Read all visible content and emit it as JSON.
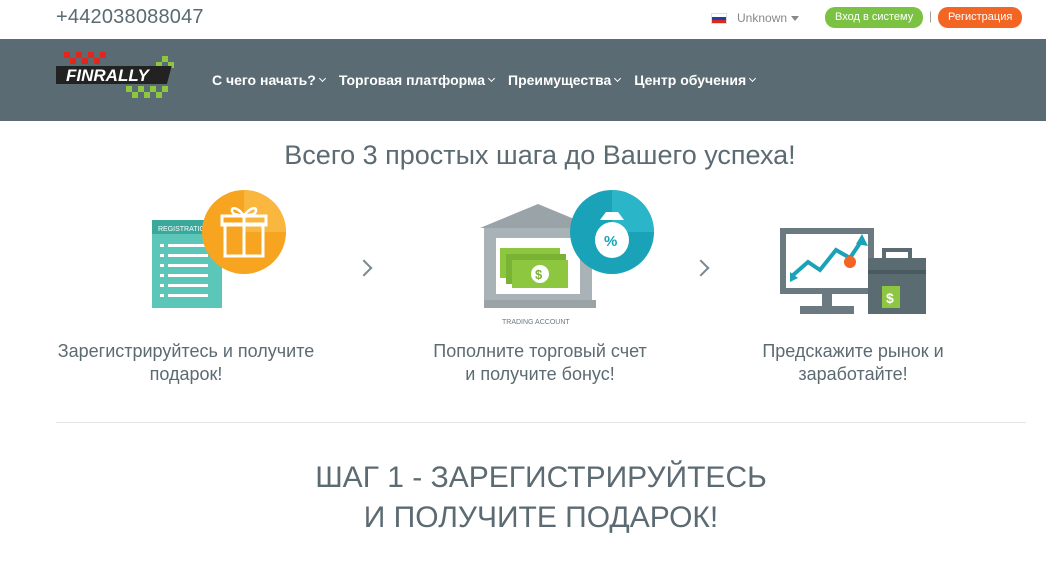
{
  "topbar": {
    "phone": "+442038088047",
    "language": "Unknown",
    "login_label": "Вход в систему",
    "separator": "|",
    "register_label": "Регистрация"
  },
  "navbar": {
    "logo_text": "FINRALLY",
    "items": [
      {
        "label": "С чего начать?"
      },
      {
        "label": "Торговая платформа"
      },
      {
        "label": "Преимущества"
      },
      {
        "label": "Центр обучения"
      }
    ]
  },
  "hero": {
    "title": "Всего 3 простых шага до Вашего успеха!",
    "steps": [
      {
        "lines": [
          "Зарегистрируйтесь и получите",
          "подарок!"
        ],
        "icon": "registration-gift-icon",
        "icon_caption": "REGISTRATION"
      },
      {
        "lines": [
          "Пополните торговый счет",
          "и получите бонус!"
        ],
        "icon": "trading-account-icon",
        "icon_caption": "TRADING ACCOUNT"
      },
      {
        "lines": [
          "Предскажите рынок и",
          "заработайте!"
        ],
        "icon": "monitor-chart-briefcase-icon"
      }
    ]
  },
  "section": {
    "heading_line1": "ШАГ 1 - ЗАРЕГИСТРИРУЙТЕСЬ",
    "heading_line2": "И ПОЛУЧИТЕ ПОДАРОК!"
  },
  "colors": {
    "nav_bg": "#5a6b73",
    "login_green": "#7cc242",
    "register_orange": "#f26522",
    "text_gray": "#5c6a72"
  }
}
